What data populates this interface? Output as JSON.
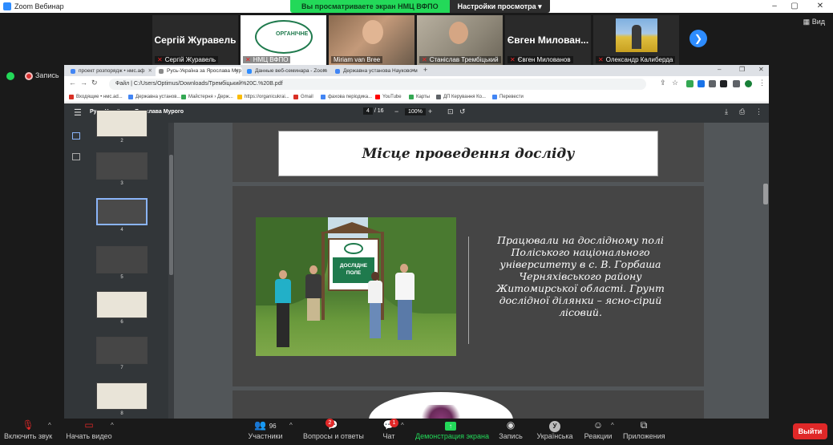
{
  "zoom": {
    "window_title": "Zoom Вебинар",
    "share_banner": "Вы просматриваете экран НМЦ ВФПО",
    "view_options": "Настройки просмотра",
    "view_button": "Вид",
    "recording": "Запись"
  },
  "participants": [
    {
      "big_name": "Сергій Журавель",
      "name": "Сергій Журавель"
    },
    {
      "name": "НМЦ ВФПО",
      "logo_text": "ОРГАНІЧНЕ"
    },
    {
      "name": "Miriam van Bree"
    },
    {
      "name": "Станіслав Трембіцький"
    },
    {
      "big_name": "Євген Милован...",
      "name": "Євген Милованов"
    },
    {
      "name": "Олександр Калиберда"
    }
  ],
  "browser": {
    "tabs": [
      {
        "label": "проект розпорядж • нмс.аф",
        "color": "#4285f4"
      },
      {
        "label": "Русь-Україна за Ярослава Мур",
        "color": "#8a8a8a"
      },
      {
        "label": "Данные веб-семинара - Zoom",
        "color": "#2d8cff"
      },
      {
        "label": "Державна установа Науково-м",
        "color": "#4285f4"
      }
    ],
    "address": "Файл  |  C:/Users/Optimus/Downloads/Трембіцький%20C.%20B.pdf",
    "bookmarks": [
      {
        "label": "Входящие • нмс.ad...",
        "color": "#d93025"
      },
      {
        "label": "Державна установ...",
        "color": "#4285f4"
      },
      {
        "label": "Майстерня › Держ...",
        "color": "#34a853"
      },
      {
        "label": "https://organicukrai...",
        "color": "#fbbc04"
      },
      {
        "label": "Gmail",
        "color": "#d93025"
      },
      {
        "label": "фахова періодика...",
        "color": "#4285f4"
      },
      {
        "label": "YouTube",
        "color": "#ff0000"
      },
      {
        "label": "Карты",
        "color": "#34a853"
      },
      {
        "label": "ДП Керування Ко...",
        "color": "#5f6368"
      },
      {
        "label": "Перевести",
        "color": "#4285f4"
      }
    ]
  },
  "pdf": {
    "title": "Русь-Україна за Ярослава Мурого",
    "current_page": "4",
    "total_pages": "/ 16",
    "zoom": "100%",
    "thumbnails": [
      "2",
      "3",
      "4",
      "5",
      "6",
      "7",
      "8"
    ]
  },
  "slide": {
    "title": "Місце проведення досліду",
    "sign_text": "ДОСЛІДНЕ ПОЛЕ",
    "body": "Працювали на дослідному полі Поліського національного університету в с. В. Горбаша Черняхівського району Житомирської області. Грунт дослідної ділянки – ясно-сірий лісовий."
  },
  "toolbar": {
    "unmute": "Включить звук",
    "start_video": "Начать видео",
    "participants": "Участники",
    "participants_count": "96",
    "qa": "Вопросы и ответы",
    "qa_badge": "2",
    "chat": "Чат",
    "chat_badge": "1",
    "share": "Демонстрация экрана",
    "record": "Запись",
    "language": "Українська",
    "reactions": "Реакции",
    "apps": "Приложения",
    "leave": "Выйти"
  },
  "colors": {
    "zoom_blue": "#2d8cff",
    "share_green": "#23d959",
    "leave_red": "#e02828",
    "pdf_toolbar": "#323639",
    "pdf_background": "#525659"
  }
}
